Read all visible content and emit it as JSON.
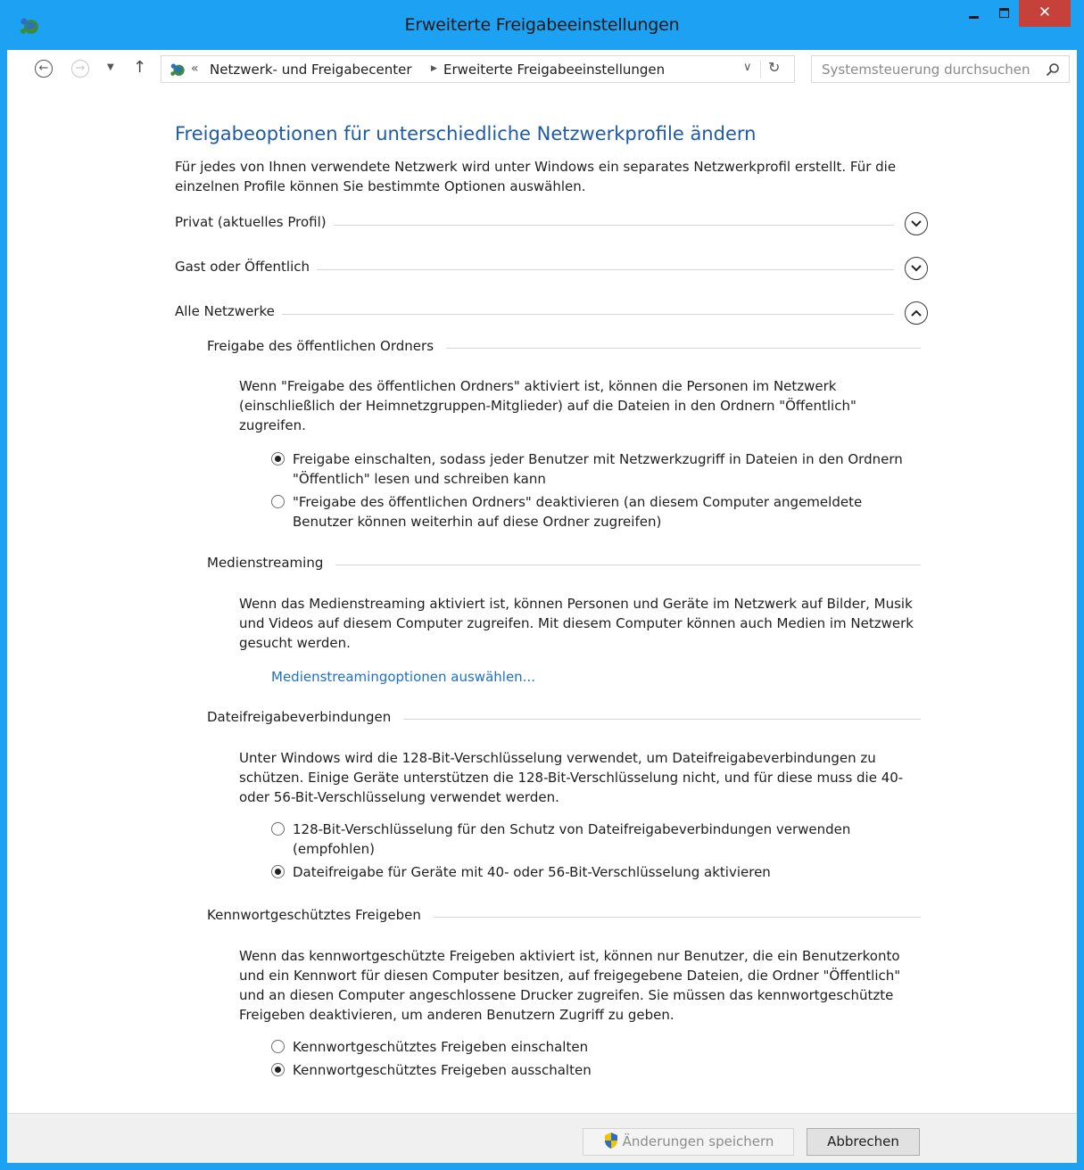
{
  "window": {
    "title": "Erweiterte Freigabeeinstellungen"
  },
  "nav": {
    "address_separator": "«",
    "breadcrumbs": [
      "Netzwerk- und Freigabecenter",
      "Erweiterte Freigabeeinstellungen"
    ],
    "search_placeholder": "Systemsteuerung durchsuchen"
  },
  "page": {
    "title": "Freigabeoptionen für unterschiedliche Netzwerkprofile ändern",
    "intro": "Für jedes von Ihnen verwendete Netzwerk wird unter Windows ein separates Netzwerkprofil erstellt. Für die einzelnen Profile können Sie bestimmte Optionen auswählen."
  },
  "profiles": [
    {
      "label": "Privat (aktuelles Profil)",
      "expanded": false
    },
    {
      "label": "Gast oder Öffentlich",
      "expanded": false
    },
    {
      "label": "Alle Netzwerke",
      "expanded": true
    }
  ],
  "sections": {
    "public_folder": {
      "heading": "Freigabe des öffentlichen Ordners",
      "description": "Wenn \"Freigabe des öffentlichen Ordners\" aktiviert ist, können die Personen im Netzwerk (einschließlich der Heimnetzgruppen-Mitglieder) auf die Dateien in den Ordnern \"Öffentlich\" zugreifen.",
      "options": [
        {
          "label": "Freigabe einschalten, sodass jeder Benutzer mit Netzwerkzugriff in Dateien in den Ordnern \"Öffentlich\" lesen und schreiben kann",
          "selected": true
        },
        {
          "label": "\"Freigabe des öffentlichen Ordners\" deaktivieren (an diesem Computer angemeldete Benutzer können weiterhin auf diese Ordner zugreifen)",
          "selected": false
        }
      ]
    },
    "media": {
      "heading": "Medienstreaming",
      "description": "Wenn das Medienstreaming aktiviert ist, können Personen und Geräte im Netzwerk auf Bilder, Musik und Videos auf diesem Computer zugreifen. Mit diesem Computer können auch Medien im Netzwerk gesucht werden.",
      "link": "Medienstreamingoptionen auswählen..."
    },
    "file_sharing": {
      "heading": "Dateifreigabeverbindungen",
      "description": "Unter Windows wird die 128-Bit-Verschlüsselung verwendet, um Dateifreigabeverbindungen zu schützen. Einige Geräte unterstützen die 128-Bit-Verschlüsselung nicht, und für diese muss die 40- oder 56-Bit-Verschlüsselung verwendet werden.",
      "options": [
        {
          "label": "128-Bit-Verschlüsselung für den Schutz von Dateifreigabeverbindungen verwenden (empfohlen)",
          "selected": false
        },
        {
          "label": "Dateifreigabe für Geräte mit 40- oder 56-Bit-Verschlüsselung aktivieren",
          "selected": true
        }
      ]
    },
    "password": {
      "heading": "Kennwortgeschütztes Freigeben",
      "description": "Wenn das kennwortgeschützte Freigeben aktiviert ist, können nur Benutzer, die ein Benutzerkonto und ein Kennwort für diesen Computer besitzen, auf freigegebene Dateien, die Ordner \"Öffentlich\" und an diesen Computer angeschlossene Drucker zugreifen. Sie müssen das kennwortgeschützte Freigeben deaktivieren, um anderen Benutzern Zugriff zu geben.",
      "options": [
        {
          "label": "Kennwortgeschütztes Freigeben einschalten",
          "selected": false
        },
        {
          "label": "Kennwortgeschütztes Freigeben ausschalten",
          "selected": true
        }
      ]
    }
  },
  "footer": {
    "save_label": "Änderungen speichern",
    "cancel_label": "Abbrechen",
    "save_enabled": false
  },
  "colors": {
    "titlebar": "#1da1f2",
    "close_button": "#c7413b",
    "heading": "#1e5aa8",
    "link": "#1e6fc9"
  }
}
